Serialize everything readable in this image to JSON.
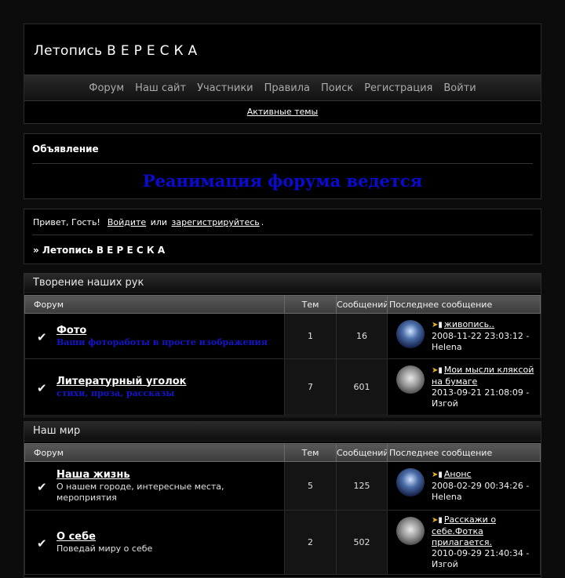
{
  "site": {
    "title": "Летопись В Е Р Е С К А"
  },
  "nav": {
    "items": [
      "Форум",
      "Наш сайт",
      "Участники",
      "Правила",
      "Поиск",
      "Регистрация",
      "Войти"
    ],
    "active_topics": "Активные темы"
  },
  "announcement": {
    "title": "Объявление",
    "text": "Реанимация форума ведется",
    "text_color": "#0a0ad0"
  },
  "welcome": {
    "greeting": "Привет, Гость!",
    "login_link": "Войдите",
    "or": "или",
    "register_link": "зарегистрируйтесь",
    "period": ".",
    "breadcrumb": "» Летопись В Е Р Е С К А"
  },
  "table_headers": {
    "forum": "Форум",
    "topics": "Тем",
    "posts": "Сообщений",
    "last": "Последнее сообщение"
  },
  "categories": [
    {
      "title": "Творение наших рук",
      "forums": [
        {
          "name": "Фото",
          "desc": "Ваши фоторaботы в просте изображения",
          "topics": "1",
          "posts": "16",
          "last_topic": "живопись..",
          "last_date": "2008-11-22 23:03:12 -",
          "last_author": "Helena",
          "avatar": "globe-avatar"
        },
        {
          "name": "Литературный уголок",
          "desc": "стихи, проза, рассказы",
          "topics": "7",
          "posts": "601",
          "last_topic": "Мои мысли кляксой на бумаге",
          "last_date": "2013-09-21 21:08:09 -",
          "last_author": "Изгой",
          "avatar": "figure-avatar"
        }
      ]
    },
    {
      "title": "Наш мир",
      "forums": [
        {
          "name": "Наша жизнь",
          "desc": "О нашем городе, интересные места, мероприятия",
          "topics": "5",
          "posts": "125",
          "last_topic": "Анонс",
          "last_date": "2008-02-29 00:34:26 -",
          "last_author": "Helena",
          "avatar": "globe-avatar"
        },
        {
          "name": "О себе",
          "desc": "Поведай миру о себе",
          "topics": "2",
          "posts": "502",
          "last_topic": "Расскажи о себе.Фотка прилагается.",
          "last_date": "2010-09-29 21:40:34 -",
          "last_author": "Изгой",
          "avatar": "figure-avatar"
        }
      ]
    }
  ]
}
